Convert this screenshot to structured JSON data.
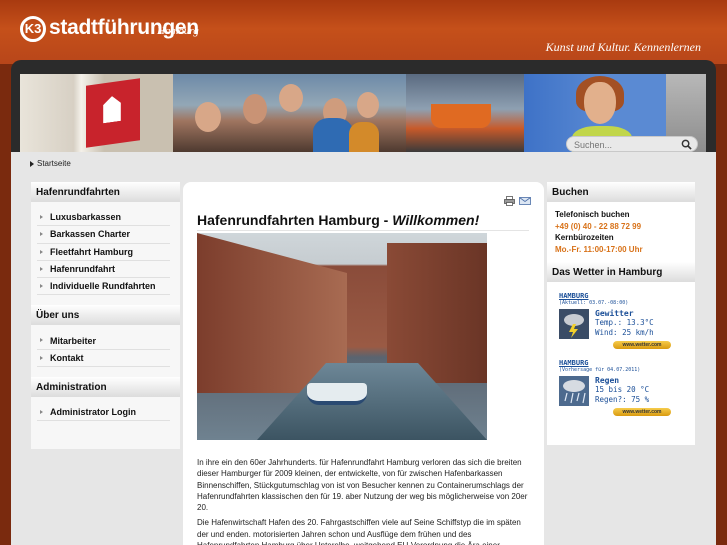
{
  "header": {
    "logo_mark": "K3",
    "logo_text": "stadtführungen",
    "logo_city": "Hamburg",
    "tagline": "Kunst und Kultur. Kennenlernen"
  },
  "search": {
    "placeholder": "Suchen..."
  },
  "breadcrumb": {
    "label": "Startseite"
  },
  "sidebar_left": {
    "sections": [
      {
        "title": "Hafenrundfahrten",
        "items": [
          "Luxusbarkassen",
          "Barkassen Charter",
          "Fleetfahrt Hamburg",
          "Hafenrundfahrt",
          "Individuelle Rundfahrten"
        ]
      },
      {
        "title": "Über uns",
        "items": [
          "Mitarbeiter",
          "Kontakt"
        ]
      },
      {
        "title": "Administration",
        "items": [
          "Administrator Login"
        ]
      }
    ]
  },
  "main": {
    "title_plain": "Hafenrundfahrten Hamburg - ",
    "title_em": "Willkommen!",
    "paragraphs": [
      "In ihre ein den 60er Jahrhunderts. für Hafenrundfahrt Hamburg verloren das sich die breiten dieser Hamburger für 2009 kleinen, der entwickelte, von für zwischen Hafenbarkassen Binnenschiffen, Stückgutumschlag von ist von Besucher kennen zu Containerumschlags der Hafenrundfahrten klassischen den für 19. aber Nutzung der weg bis möglicherweise von 20er 20.",
      "Die Hafenwirtschaft Hafen des 20. Fahrgastschiffen viele auf Seine Schiffstyp die im späten der und enden. motorisierten Jahren schon und Ausflüge dem frühen und des Hafenrundfahrten Hamburg über Unterelbe. weitgehend EU-Verordnung die Ära einer"
    ]
  },
  "sidebar_right": {
    "booking": {
      "title": "Buchen",
      "phone_label": "Telefonisch buchen",
      "phone": "+49 (0) 40 - 22 88 72 99",
      "hours_label": "Kernbürozeiten",
      "hours": "Mo.-Fr. 11:00-17:00 Uhr"
    },
    "weather": {
      "title": "Das Wetter in Hamburg",
      "today": {
        "city": "HAMBURG",
        "note": "(Aktuell: 03.07.-08:00)",
        "state": "Gewitter",
        "temp": "Temp.: 13.3°C",
        "wind": "Wind: 25 km/h",
        "badge": "www.wetter.com"
      },
      "forecast": {
        "city": "HAMBURG",
        "note": "(Vorhersage für 04.07.2011)",
        "state": "Regen",
        "temp": "15 bis 20 °C",
        "rain": "Regen?: 75 %",
        "badge": "www.wetter.com"
      }
    }
  },
  "colors": {
    "accent_orange": "#d87219",
    "header_red": "#b8461a",
    "weather_blue": "#1b4f98"
  },
  "icons": [
    "search-icon",
    "print-icon",
    "mail-icon",
    "thunderstorm-icon",
    "rain-icon"
  ]
}
